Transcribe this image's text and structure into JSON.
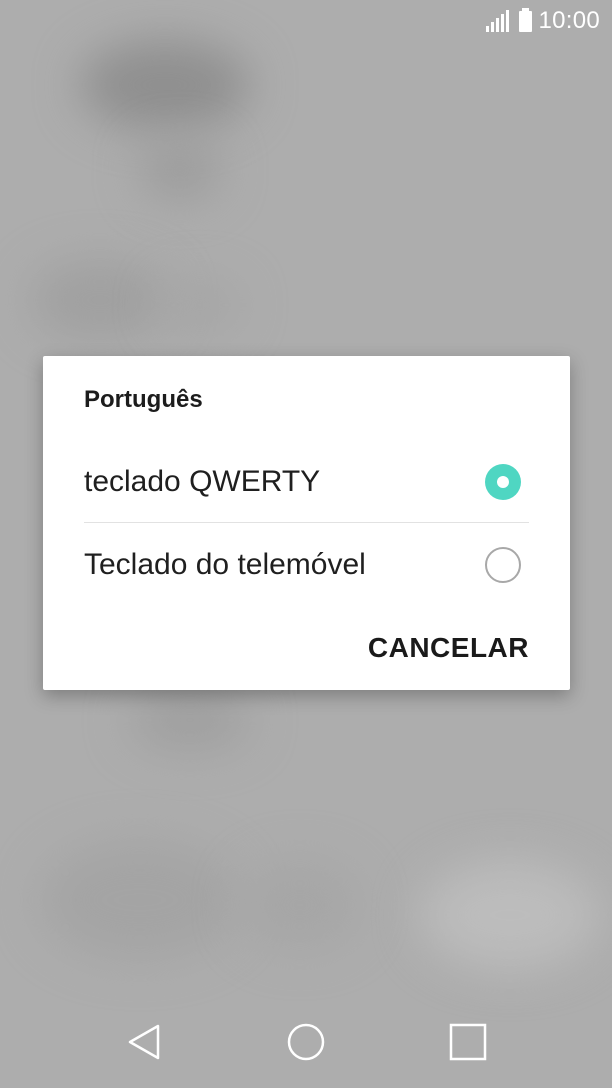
{
  "status_bar": {
    "time": "10:00",
    "icons": [
      "signal-icon",
      "battery-icon"
    ]
  },
  "dialog": {
    "title": "Português",
    "options": [
      {
        "label": "teclado QWERTY",
        "selected": true
      },
      {
        "label": "Teclado do telemóvel",
        "selected": false
      }
    ],
    "cancel_label": "CANCELAR",
    "accent_color": "#4fd6c2"
  },
  "nav_bar": {
    "icons": [
      "back-icon",
      "home-icon",
      "recents-icon"
    ]
  }
}
